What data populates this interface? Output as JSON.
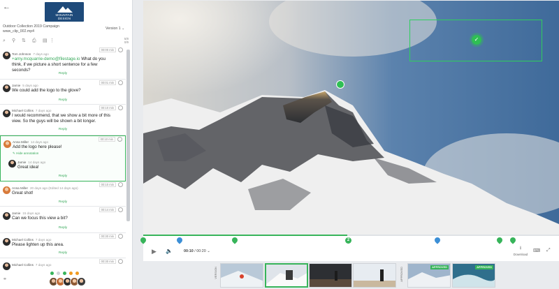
{
  "left_panel": {
    "back_icon": "back-arrow-icon",
    "logo_text_1": "MOUNTAIN",
    "logo_text_2": "DESIGN",
    "campaign": "Outdoor Collection 2019 Campaign",
    "file": "www_clip_002.mp4",
    "version": "Version 1  ⌄",
    "toolbar_count_top": "5/8",
    "toolbar_count_bottom": "0/9",
    "comments": [
      {
        "name": "Tom Johnson",
        "ago": "7 days ago",
        "time": "00:00 min",
        "mention": "+amy.mcquarrie-demo@filestage.io",
        "text": " What do you think, if we picture a short sentence for a few seconds?",
        "reply": "Reply"
      },
      {
        "name": "Jamie",
        "ago": "5 days ago",
        "time": "00:01 min",
        "text": "We could add the logo to the glove?",
        "reply": "Reply"
      },
      {
        "name": "Michael Collins",
        "ago": "7 days ago",
        "time": "00:10 min",
        "text": "I would recommend, that we show a bit more of this view. So the guys will be shown a bit longer.",
        "reply": "Reply"
      },
      {
        "name": "Anna Miller",
        "ago": "14 days ago",
        "time": "00:10 min",
        "text": "Add the logo here please!",
        "hide": "Hide annotation",
        "sub_name": "Jamie",
        "sub_ago": "14 days ago",
        "sub_text": "Great idea!",
        "reply": "Reply"
      },
      {
        "name": "Anna Miller",
        "ago": "20 days ago (Edited 14 days ago)",
        "time": "00:10 min",
        "text": "Great shot!",
        "reply": "Reply"
      },
      {
        "name": "Jamie",
        "ago": "15 days ago",
        "time": "00:14 min",
        "text": "Can we focus this view a bit?",
        "reply": "Reply"
      },
      {
        "name": "Michael Collins",
        "ago": "7 days ago",
        "time": "00:30 min",
        "text": "Please lighten up this area.",
        "reply": "Reply"
      },
      {
        "name": "Michael Collins",
        "ago": "7 days ago",
        "time": "00:30 min"
      }
    ]
  },
  "player": {
    "time_current": "00:10",
    "time_total": "/ 00:20",
    "download_label": "Download",
    "marker_number": "2",
    "progress_fraction": 0.49
  },
  "filmstrip": {
    "label_left": "VERSION",
    "label_right": "APPROVED",
    "approved_badge": "APPROVED"
  },
  "colors": {
    "accent": "#37b45a",
    "marker_blue": "#3c8fd6",
    "sidebar_bg": "#ffffff"
  }
}
